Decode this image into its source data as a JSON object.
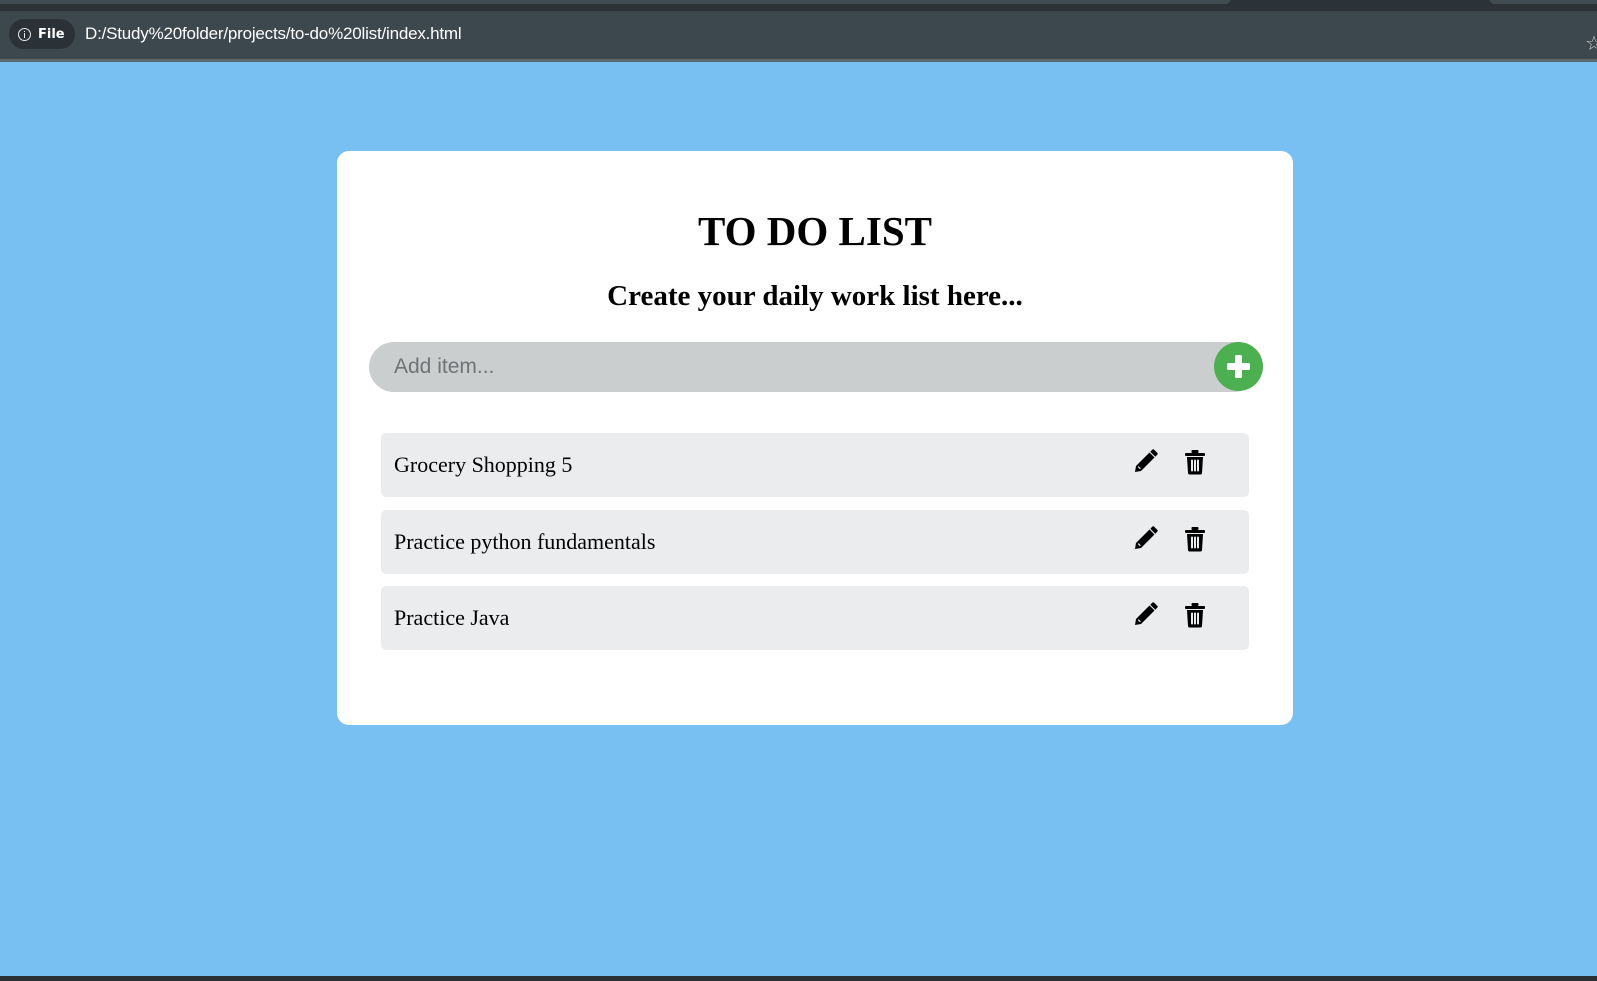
{
  "browser": {
    "chip_label": "File",
    "url": "D:/Study%20folder/projects/to-do%20list/index.html",
    "icons": {
      "site_info": "info-icon",
      "bookmark": "star-icon"
    }
  },
  "app": {
    "title": "TO DO LIST",
    "subtitle": "Create your daily work list here...",
    "input": {
      "placeholder": "Add item...",
      "value": ""
    },
    "add_button_icon": "plus-icon",
    "items": [
      {
        "text": "Grocery Shopping 5",
        "edit_icon": "pencil-icon",
        "delete_icon": "trash-icon"
      },
      {
        "text": "Practice python fundamentals",
        "edit_icon": "pencil-icon",
        "delete_icon": "trash-icon"
      },
      {
        "text": "Practice Java",
        "edit_icon": "pencil-icon",
        "delete_icon": "trash-icon"
      }
    ]
  },
  "colors": {
    "page_background": "#78c0f2",
    "card_background": "#ffffff",
    "input_background": "#cbcecf",
    "add_button": "#4caf50",
    "item_background": "#ebecee",
    "browser_toolbar": "#3c474e"
  }
}
